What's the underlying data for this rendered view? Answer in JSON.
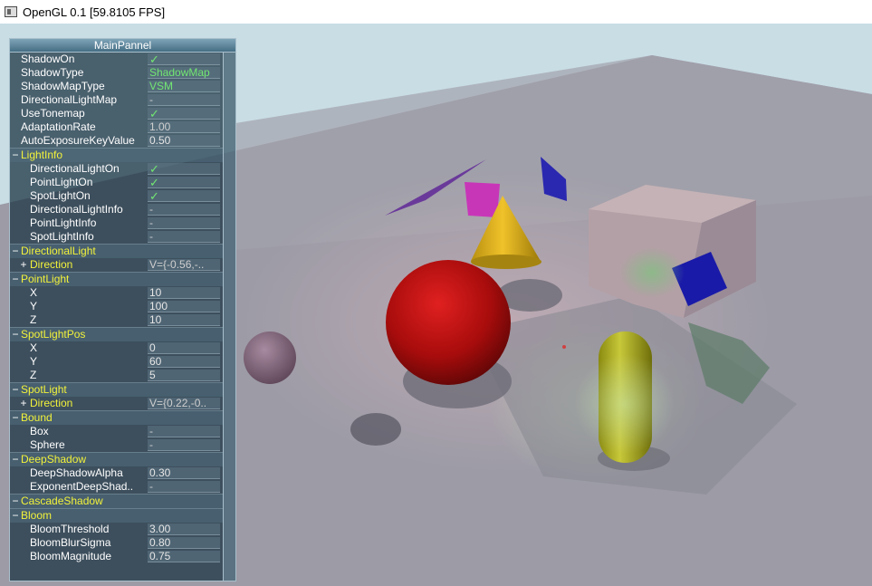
{
  "window": {
    "title": "OpenGL 0.1 [59.8105 FPS]"
  },
  "panel": {
    "title": "MainPannel",
    "rows": [
      {
        "label": "ShadowOn",
        "value": "✓",
        "kind": "check",
        "level": 0
      },
      {
        "label": "ShadowType",
        "value": "ShadowMap",
        "kind": "green",
        "level": 0
      },
      {
        "label": "ShadowMapType",
        "value": "VSM",
        "kind": "green",
        "level": 0
      },
      {
        "label": "DirectionalLightMap",
        "value": "-",
        "kind": "dim",
        "level": 0
      },
      {
        "label": "UseTonemap",
        "value": "✓",
        "kind": "check",
        "level": 0
      },
      {
        "label": "AdaptationRate",
        "value": "1.00",
        "kind": "dim",
        "level": 0
      },
      {
        "label": "AutoExposureKeyValue",
        "value": "0.50",
        "kind": "normal",
        "level": 0
      },
      {
        "label": "LightInfo",
        "toggle": "−",
        "group": true
      },
      {
        "label": "DirectionalLightOn",
        "value": "✓",
        "kind": "check",
        "level": 1
      },
      {
        "label": "PointLightOn",
        "value": "✓",
        "kind": "check",
        "level": 1
      },
      {
        "label": "SpotLightOn",
        "value": "✓",
        "kind": "check",
        "level": 1
      },
      {
        "label": "DirectionalLightInfo",
        "value": "-",
        "kind": "dim",
        "level": 1
      },
      {
        "label": "PointLightInfo",
        "value": "-",
        "kind": "dim",
        "level": 1
      },
      {
        "label": "SpotLightInfo",
        "value": "-",
        "kind": "dim",
        "level": 1
      },
      {
        "label": "DirectionalLight",
        "toggle": "−",
        "group": true
      },
      {
        "label": "Direction",
        "value": "V={-0.56,-..",
        "kind": "dim",
        "level": 1,
        "toggle": "+",
        "yellow": true
      },
      {
        "label": "PointLight",
        "toggle": "−",
        "group": true
      },
      {
        "label": "X",
        "value": "10",
        "kind": "normal",
        "level": 1
      },
      {
        "label": "Y",
        "value": "100",
        "kind": "normal",
        "level": 1
      },
      {
        "label": "Z",
        "value": "10",
        "kind": "normal",
        "level": 1
      },
      {
        "label": "SpotLightPos",
        "toggle": "−",
        "group": true
      },
      {
        "label": "X",
        "value": "0",
        "kind": "normal",
        "level": 1
      },
      {
        "label": "Y",
        "value": "60",
        "kind": "normal",
        "level": 1
      },
      {
        "label": "Z",
        "value": "5",
        "kind": "normal",
        "level": 1
      },
      {
        "label": "SpotLight",
        "toggle": "−",
        "group": true
      },
      {
        "label": "Direction",
        "value": "V={0.22,-0..",
        "kind": "dim",
        "level": 1,
        "toggle": "+",
        "yellow": true
      },
      {
        "label": "Bound",
        "toggle": "−",
        "group": true
      },
      {
        "label": "Box",
        "value": "-",
        "kind": "dim",
        "level": 1
      },
      {
        "label": "Sphere",
        "value": "-",
        "kind": "dim",
        "level": 1
      },
      {
        "label": "DeepShadow",
        "toggle": "−",
        "group": true
      },
      {
        "label": "DeepShadowAlpha",
        "value": "0.30",
        "kind": "normal",
        "level": 1
      },
      {
        "label": "ExponentDeepShad..",
        "value": "-",
        "kind": "dim",
        "level": 1
      },
      {
        "label": "CascadeShadow",
        "toggle": "−",
        "group": true
      },
      {
        "label": "Bloom",
        "toggle": "−",
        "group": true
      },
      {
        "label": "BloomThreshold",
        "value": "3.00",
        "kind": "normal",
        "level": 1
      },
      {
        "label": "BloomBlurSigma",
        "value": "0.80",
        "kind": "normal",
        "level": 1
      },
      {
        "label": "BloomMagnitude",
        "value": "0.75",
        "kind": "normal",
        "level": 1
      }
    ]
  }
}
